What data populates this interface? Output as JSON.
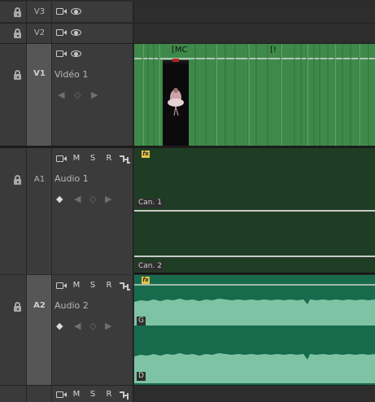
{
  "tracks": {
    "v3": {
      "name": "V3"
    },
    "v2": {
      "name": "V2"
    },
    "v1": {
      "name": "V1",
      "label": "Vidéo 1"
    },
    "a1": {
      "name": "A1",
      "label": "Audio 1",
      "btn_m": "M",
      "btn_s": "S",
      "btn_r": "R"
    },
    "a2": {
      "name": "A2",
      "label": "Audio 2",
      "btn_m": "M",
      "btn_s": "S",
      "btn_r": "R"
    },
    "a3": {
      "btn_m": "M",
      "btn_s": "S",
      "btn_r": "R"
    }
  },
  "clips": {
    "v1_title_1": "[MC",
    "v1_title_2": "[!",
    "a1_ch1": "Can. 1",
    "a1_ch2": "Can. 2",
    "a2_ch_l": "G",
    "a2_ch_r": "D",
    "fx": "fx"
  },
  "icons": {
    "lock": "lock-icon",
    "camera": "camera-icon",
    "eye": "eye-icon",
    "keyframe": "keyframe-diamond-icon",
    "prev": "prev-keyframe-icon",
    "next": "next-keyframe-icon",
    "sync": "sync-lock-icon"
  },
  "colors": {
    "video_clip": "#3f8a4a",
    "video_clip_line": "#6ab870",
    "audio1_clip": "#1f3d24",
    "audio2_clip": "#176b4c",
    "audio2_wave": "#7ec4a4",
    "fx_badge": "#e4c448"
  }
}
